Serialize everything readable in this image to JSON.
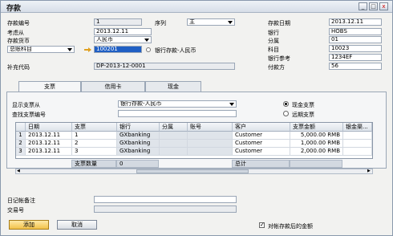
{
  "window": {
    "title": "存款",
    "min": "_",
    "max": "□",
    "close": "x"
  },
  "left": {
    "deposit_no_label": "存款编号",
    "deposit_no": "1",
    "series_label": "序列",
    "series": "主",
    "consider_from_label": "考虑从",
    "consider_from": "2013.12.11",
    "deposit_currency_label": "存款货币",
    "deposit_currency": "人民币",
    "gl_account_label": "总账科目",
    "gl_account": "100201",
    "gl_account_desc": "银行存款-人民币",
    "supp_code_label": "补充代码",
    "supp_code": "DP-2013-12-0001"
  },
  "right": {
    "deposit_date_label": "存款日期",
    "deposit_date": "2013.12.11",
    "bank_label": "银行",
    "bank": "HOBS",
    "branch_label": "分属",
    "branch": "01",
    "account_label": "科目",
    "account": "10023",
    "bank_ref_label": "银行参考",
    "bank_ref": "1234EF",
    "payer_label": "付款方",
    "payer": "56"
  },
  "tabs": [
    "支票",
    "信用卡",
    "现金"
  ],
  "panel": {
    "show_checks_from_label": "显示支票从",
    "show_checks_from": "银行存款-人民币",
    "find_check_label": "查找支票编号",
    "radio_cash": "现金支票",
    "radio_deferred": "远期支票"
  },
  "grid": {
    "columns": [
      "",
      "日期",
      "支票",
      "银行",
      "分属",
      "账号",
      "客户",
      "支票金额",
      "银金渠..."
    ],
    "rows": [
      {
        "n": "1",
        "date": "2013.12.11",
        "check": "1",
        "bank": "GXbanking",
        "branch": "",
        "acct": "",
        "customer": "Customer",
        "amount": "5,000.00 RMB"
      },
      {
        "n": "2",
        "date": "2013.12.11",
        "check": "2",
        "bank": "GXbanking",
        "branch": "",
        "acct": "",
        "customer": "Customer",
        "amount": "1,000.00 RMB"
      },
      {
        "n": "3",
        "date": "2013.12.11",
        "check": "3",
        "bank": "GXbanking",
        "branch": "",
        "acct": "",
        "customer": "Customer",
        "amount": "2,000.00 RMB"
      }
    ],
    "totals": {
      "count_label": "支票数量",
      "count": "0",
      "total_label": "总计"
    }
  },
  "bottom": {
    "journal_remark_label": "日记帐备注",
    "trans_no_label": "交易号",
    "add_button": "添加",
    "cancel_button": "取消",
    "post_checkbox": "对帐存款后的金额"
  }
}
